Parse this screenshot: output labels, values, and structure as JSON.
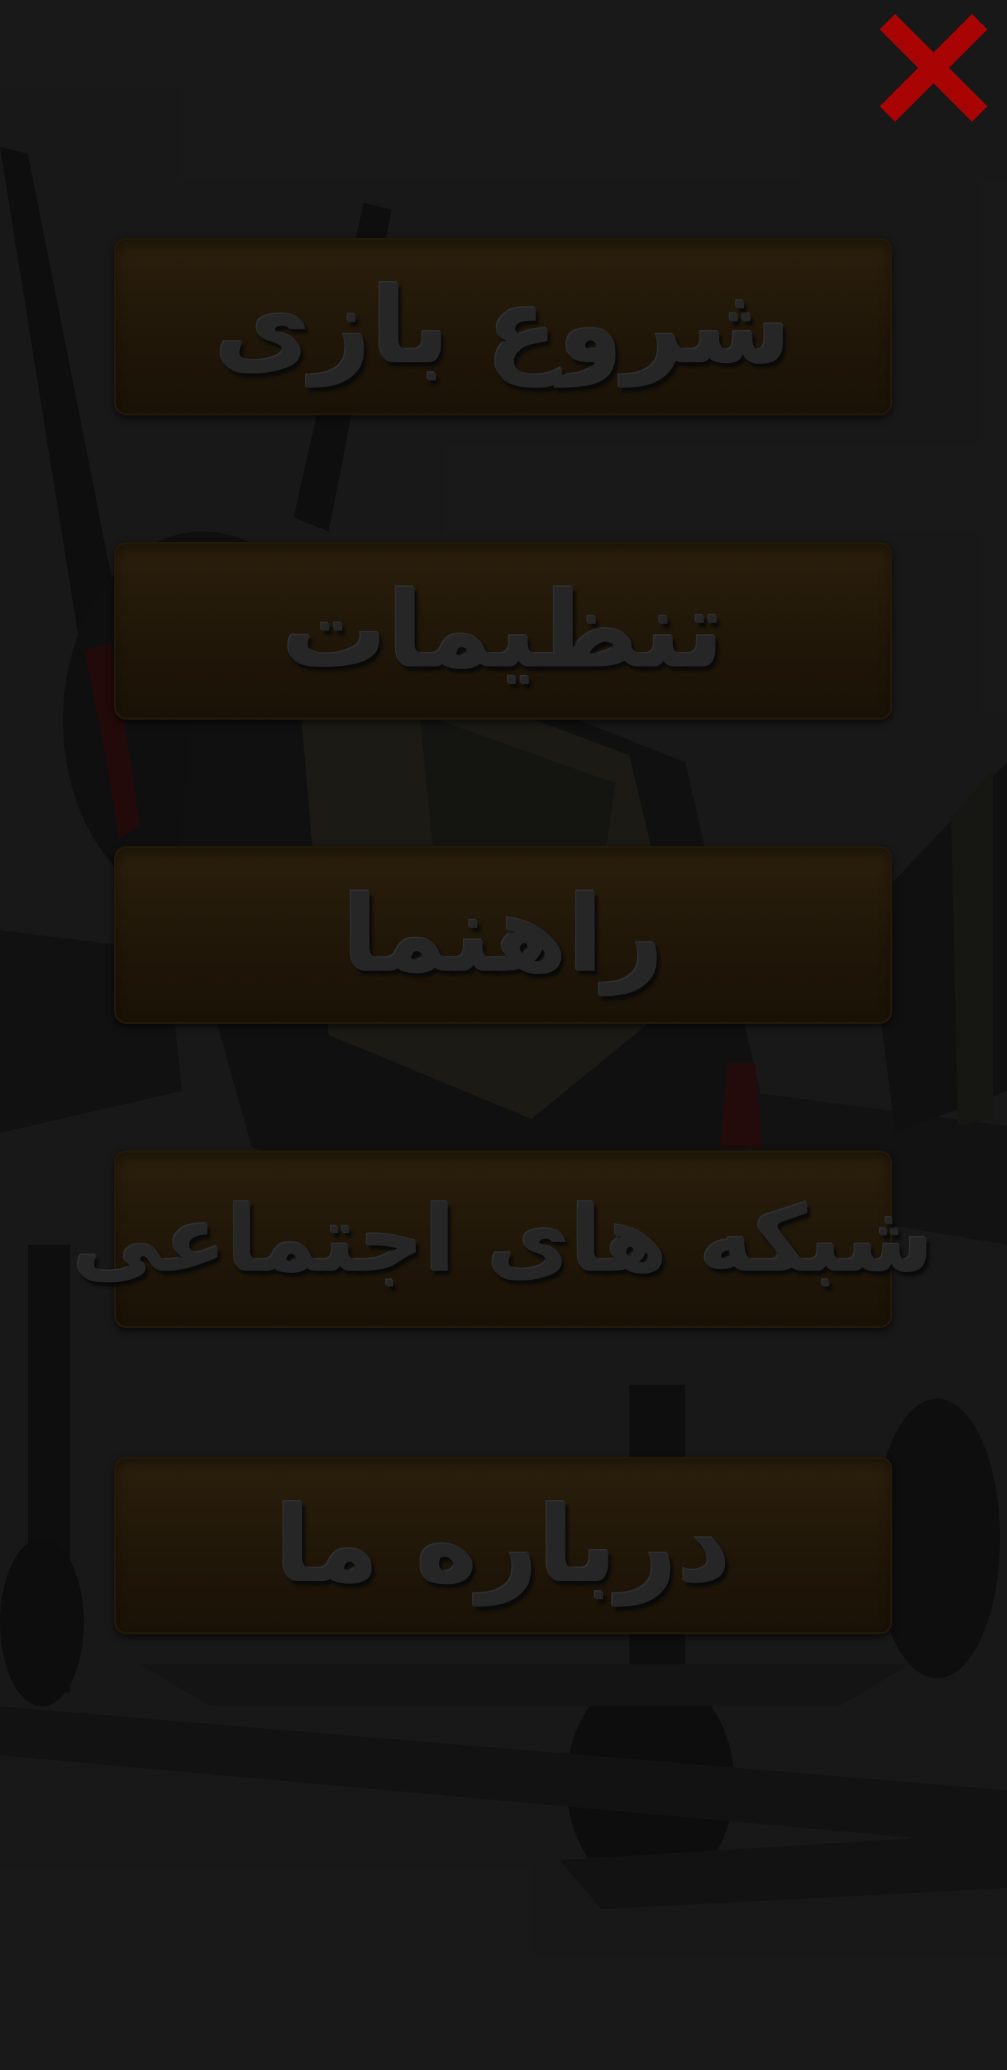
{
  "header": {
    "close_icon": "close-icon",
    "close_color": "#a80404"
  },
  "menu": {
    "items": [
      {
        "label": "شروع بازی"
      },
      {
        "label": "تنظیمات"
      },
      {
        "label": "راهنما"
      },
      {
        "label": "شبکه های اجتماعی"
      },
      {
        "label": "درباره ما"
      }
    ]
  },
  "background": {
    "art": "plane-illustration"
  }
}
